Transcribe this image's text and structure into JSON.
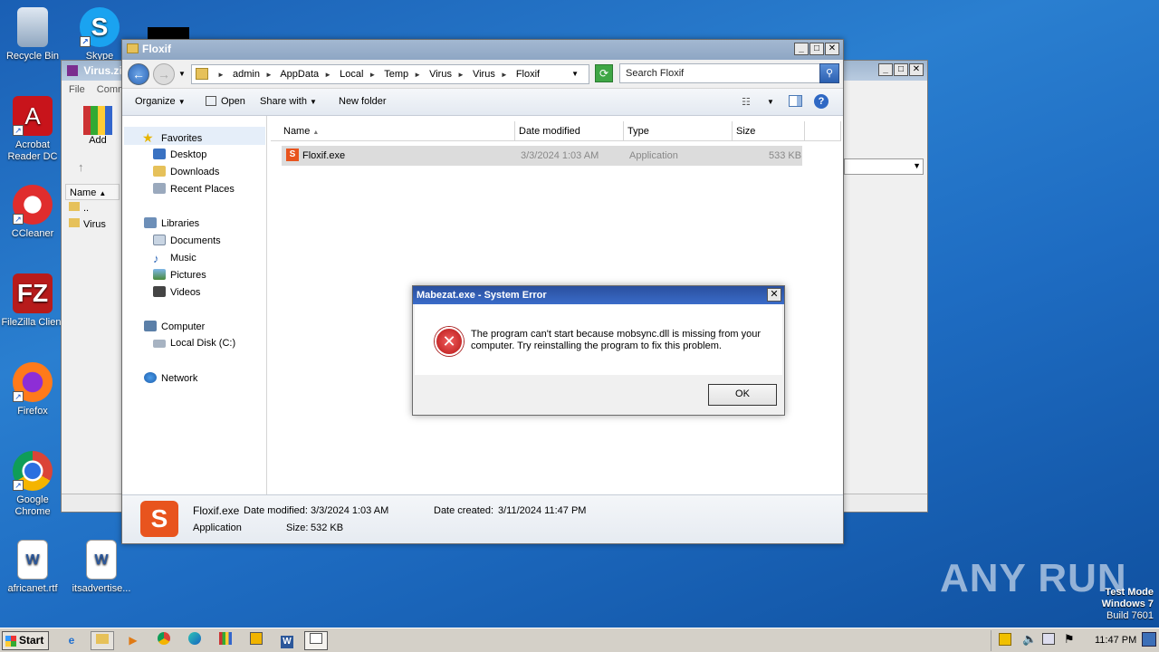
{
  "desktop": {
    "icons": [
      {
        "label": "Recycle Bin"
      },
      {
        "label": "Skype"
      },
      {
        "label": "Acrobat Reader DC"
      },
      {
        "label": "CCleaner"
      },
      {
        "label": "FileZilla Client"
      },
      {
        "label": "Firefox"
      },
      {
        "label": "Google Chrome"
      },
      {
        "label": "africanet.rtf"
      },
      {
        "label": "itsadvertise..."
      }
    ]
  },
  "bg_window": {
    "title": "Virus.zip",
    "menu": [
      "File",
      "Comm"
    ],
    "add_label": "Add",
    "col_name": "Name",
    "rows": [
      "..",
      "Virus"
    ]
  },
  "explorer": {
    "title": "Floxif",
    "breadcrumb": [
      "admin",
      "AppData",
      "Local",
      "Temp",
      "Virus",
      "Virus",
      "Floxif"
    ],
    "search_placeholder": "Search Floxif",
    "toolbar": {
      "organize": "Organize",
      "open": "Open",
      "share_with": "Share with",
      "new_folder": "New folder"
    },
    "nav": {
      "favorites": "Favorites",
      "desktop": "Desktop",
      "downloads": "Downloads",
      "recent_places": "Recent Places",
      "libraries": "Libraries",
      "documents": "Documents",
      "music": "Music",
      "pictures": "Pictures",
      "videos": "Videos",
      "computer": "Computer",
      "local_disk": "Local Disk (C:)",
      "network": "Network"
    },
    "columns": {
      "name": "Name",
      "date_modified": "Date modified",
      "type": "Type",
      "size": "Size"
    },
    "file": {
      "name": "Floxif.exe",
      "date_modified": "3/3/2024 1:03 AM",
      "type": "Application",
      "size": "533 KB"
    },
    "details": {
      "name": "Floxif.exe",
      "type": "Application",
      "date_modified_label": "Date modified:",
      "date_modified": "3/3/2024 1:03 AM",
      "size_label": "Size:",
      "size": "532 KB",
      "date_created_label": "Date created:",
      "date_created": "3/11/2024 11:47 PM"
    }
  },
  "dialog": {
    "title": "Mabezat.exe - System Error",
    "message": "The program can't start because mobsync.dll is missing from your computer. Try reinstalling the program to fix this problem.",
    "ok_label": "OK"
  },
  "taskbar": {
    "start_label": "Start",
    "clock": "11:47 PM"
  },
  "watermark": {
    "brand": "ANY RUN",
    "test_mode": "Test Mode",
    "os": "Windows 7",
    "build": "Build 7601"
  }
}
